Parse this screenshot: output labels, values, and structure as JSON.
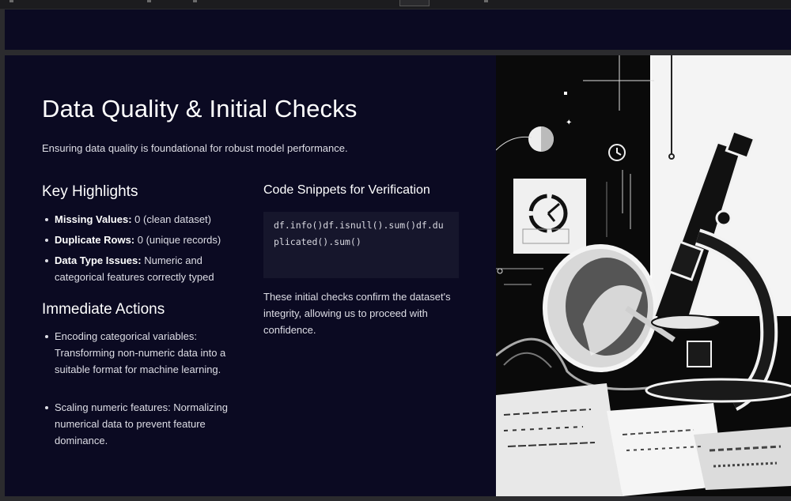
{
  "slide": {
    "title": "Data Quality & Initial Checks",
    "subtitle": "Ensuring data quality is foundational for robust model performance.",
    "key_highlights": {
      "heading": "Key Highlights",
      "items": [
        {
          "label": "Missing Values:",
          "text": " 0 (clean dataset)"
        },
        {
          "label": "Duplicate Rows:",
          "text": " 0 (unique records)"
        },
        {
          "label": "Data Type Issues:",
          "text": " Numeric and categorical features correctly typed"
        }
      ]
    },
    "immediate_actions": {
      "heading": "Immediate Actions",
      "items": [
        "Encoding categorical variables: Transforming non-numeric data into a suitable format for machine learning.",
        "Scaling numeric features: Normalizing numerical data to prevent feature dominance."
      ]
    },
    "code_section": {
      "heading": "Code Snippets for Verification",
      "code": "df.info()df.isnull().sum()df.duplicated().sum()",
      "paragraph": "These initial checks confirm the dataset's integrity, allowing us to proceed with confidence."
    },
    "illustration_icon": "microscope-illustration"
  },
  "colors": {
    "slide_background": "#0b0a22",
    "code_background": "#16162c",
    "text_primary": "#ffffff",
    "text_secondary": "#dedee6"
  }
}
